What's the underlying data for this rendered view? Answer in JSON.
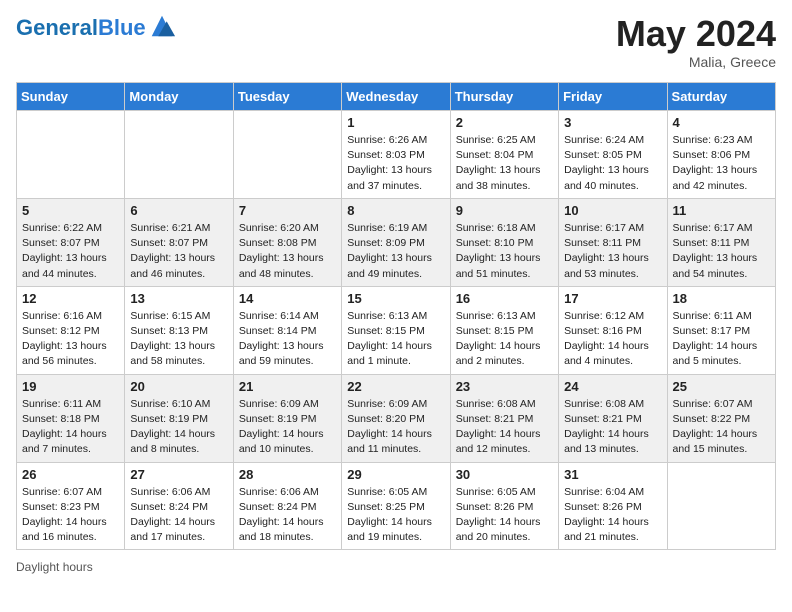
{
  "logo": {
    "text_general": "General",
    "text_blue": "Blue"
  },
  "title": {
    "month_year": "May 2024",
    "location": "Malia, Greece"
  },
  "days_of_week": [
    "Sunday",
    "Monday",
    "Tuesday",
    "Wednesday",
    "Thursday",
    "Friday",
    "Saturday"
  ],
  "weeks": [
    [
      {
        "num": "",
        "info": ""
      },
      {
        "num": "",
        "info": ""
      },
      {
        "num": "",
        "info": ""
      },
      {
        "num": "1",
        "info": "Sunrise: 6:26 AM\nSunset: 8:03 PM\nDaylight: 13 hours\nand 37 minutes."
      },
      {
        "num": "2",
        "info": "Sunrise: 6:25 AM\nSunset: 8:04 PM\nDaylight: 13 hours\nand 38 minutes."
      },
      {
        "num": "3",
        "info": "Sunrise: 6:24 AM\nSunset: 8:05 PM\nDaylight: 13 hours\nand 40 minutes."
      },
      {
        "num": "4",
        "info": "Sunrise: 6:23 AM\nSunset: 8:06 PM\nDaylight: 13 hours\nand 42 minutes."
      }
    ],
    [
      {
        "num": "5",
        "info": "Sunrise: 6:22 AM\nSunset: 8:07 PM\nDaylight: 13 hours\nand 44 minutes."
      },
      {
        "num": "6",
        "info": "Sunrise: 6:21 AM\nSunset: 8:07 PM\nDaylight: 13 hours\nand 46 minutes."
      },
      {
        "num": "7",
        "info": "Sunrise: 6:20 AM\nSunset: 8:08 PM\nDaylight: 13 hours\nand 48 minutes."
      },
      {
        "num": "8",
        "info": "Sunrise: 6:19 AM\nSunset: 8:09 PM\nDaylight: 13 hours\nand 49 minutes."
      },
      {
        "num": "9",
        "info": "Sunrise: 6:18 AM\nSunset: 8:10 PM\nDaylight: 13 hours\nand 51 minutes."
      },
      {
        "num": "10",
        "info": "Sunrise: 6:17 AM\nSunset: 8:11 PM\nDaylight: 13 hours\nand 53 minutes."
      },
      {
        "num": "11",
        "info": "Sunrise: 6:17 AM\nSunset: 8:11 PM\nDaylight: 13 hours\nand 54 minutes."
      }
    ],
    [
      {
        "num": "12",
        "info": "Sunrise: 6:16 AM\nSunset: 8:12 PM\nDaylight: 13 hours\nand 56 minutes."
      },
      {
        "num": "13",
        "info": "Sunrise: 6:15 AM\nSunset: 8:13 PM\nDaylight: 13 hours\nand 58 minutes."
      },
      {
        "num": "14",
        "info": "Sunrise: 6:14 AM\nSunset: 8:14 PM\nDaylight: 13 hours\nand 59 minutes."
      },
      {
        "num": "15",
        "info": "Sunrise: 6:13 AM\nSunset: 8:15 PM\nDaylight: 14 hours\nand 1 minute."
      },
      {
        "num": "16",
        "info": "Sunrise: 6:13 AM\nSunset: 8:15 PM\nDaylight: 14 hours\nand 2 minutes."
      },
      {
        "num": "17",
        "info": "Sunrise: 6:12 AM\nSunset: 8:16 PM\nDaylight: 14 hours\nand 4 minutes."
      },
      {
        "num": "18",
        "info": "Sunrise: 6:11 AM\nSunset: 8:17 PM\nDaylight: 14 hours\nand 5 minutes."
      }
    ],
    [
      {
        "num": "19",
        "info": "Sunrise: 6:11 AM\nSunset: 8:18 PM\nDaylight: 14 hours\nand 7 minutes."
      },
      {
        "num": "20",
        "info": "Sunrise: 6:10 AM\nSunset: 8:19 PM\nDaylight: 14 hours\nand 8 minutes."
      },
      {
        "num": "21",
        "info": "Sunrise: 6:09 AM\nSunset: 8:19 PM\nDaylight: 14 hours\nand 10 minutes."
      },
      {
        "num": "22",
        "info": "Sunrise: 6:09 AM\nSunset: 8:20 PM\nDaylight: 14 hours\nand 11 minutes."
      },
      {
        "num": "23",
        "info": "Sunrise: 6:08 AM\nSunset: 8:21 PM\nDaylight: 14 hours\nand 12 minutes."
      },
      {
        "num": "24",
        "info": "Sunrise: 6:08 AM\nSunset: 8:21 PM\nDaylight: 14 hours\nand 13 minutes."
      },
      {
        "num": "25",
        "info": "Sunrise: 6:07 AM\nSunset: 8:22 PM\nDaylight: 14 hours\nand 15 minutes."
      }
    ],
    [
      {
        "num": "26",
        "info": "Sunrise: 6:07 AM\nSunset: 8:23 PM\nDaylight: 14 hours\nand 16 minutes."
      },
      {
        "num": "27",
        "info": "Sunrise: 6:06 AM\nSunset: 8:24 PM\nDaylight: 14 hours\nand 17 minutes."
      },
      {
        "num": "28",
        "info": "Sunrise: 6:06 AM\nSunset: 8:24 PM\nDaylight: 14 hours\nand 18 minutes."
      },
      {
        "num": "29",
        "info": "Sunrise: 6:05 AM\nSunset: 8:25 PM\nDaylight: 14 hours\nand 19 minutes."
      },
      {
        "num": "30",
        "info": "Sunrise: 6:05 AM\nSunset: 8:26 PM\nDaylight: 14 hours\nand 20 minutes."
      },
      {
        "num": "31",
        "info": "Sunrise: 6:04 AM\nSunset: 8:26 PM\nDaylight: 14 hours\nand 21 minutes."
      },
      {
        "num": "",
        "info": ""
      }
    ]
  ],
  "footer": {
    "label": "Daylight hours"
  }
}
